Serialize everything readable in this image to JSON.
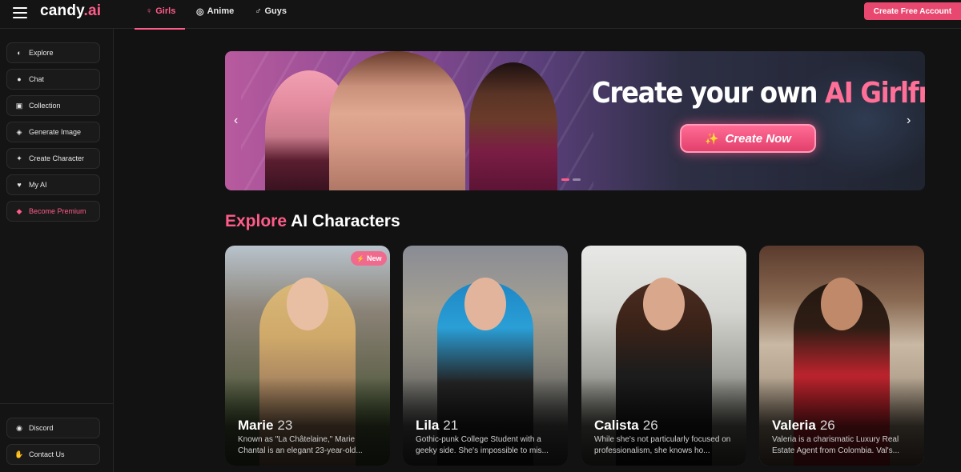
{
  "app": {
    "logo_main": "candy",
    "logo_dot": ".ai"
  },
  "tabs": [
    {
      "label": "Girls",
      "icon": "female-icon",
      "active": true
    },
    {
      "label": "Anime",
      "icon": "anime-icon",
      "active": false
    },
    {
      "label": "Guys",
      "icon": "male-icon",
      "active": false
    }
  ],
  "header": {
    "create_account_label": "Create Free Account"
  },
  "sidebar": {
    "items": [
      {
        "label": "Explore",
        "icon": "compass-icon"
      },
      {
        "label": "Chat",
        "icon": "chat-icon"
      },
      {
        "label": "Collection",
        "icon": "collection-icon"
      },
      {
        "label": "Generate Image",
        "icon": "image-icon"
      },
      {
        "label": "Create Character",
        "icon": "magic-wand-icon"
      },
      {
        "label": "My AI",
        "icon": "heart-icon"
      },
      {
        "label": "Become Premium",
        "icon": "diamond-icon"
      }
    ],
    "bottom_items": [
      {
        "label": "Discord",
        "icon": "discord-icon"
      },
      {
        "label": "Contact Us",
        "icon": "handshake-icon"
      }
    ]
  },
  "banner": {
    "title_prefix": "Create your own",
    "title_highlight": "AI Girlfriend",
    "cta_label": "Create Now"
  },
  "section": {
    "title_highlight": "Explore",
    "title_rest": "AI Characters"
  },
  "characters": [
    {
      "name": "Marie",
      "age": "23",
      "badge": "New",
      "description": "Known as \"La Châtelaine,\" Marie Chantal is an elegant 23-year-old..."
    },
    {
      "name": "Lila",
      "age": "21",
      "badge": "",
      "description": "Gothic-punk College Student with a geeky side. She's impossible to mis..."
    },
    {
      "name": "Calista",
      "age": "26",
      "badge": "",
      "description": "While she's not particularly focused on professionalism, she knows ho..."
    },
    {
      "name": "Valeria",
      "age": "26",
      "badge": "",
      "description": "Valeria is a charismatic Luxury Real Estate Agent from Colombia. Val's..."
    }
  ],
  "colors": {
    "accent": "#ff5c8a",
    "background": "#121212",
    "panel": "#141414"
  }
}
